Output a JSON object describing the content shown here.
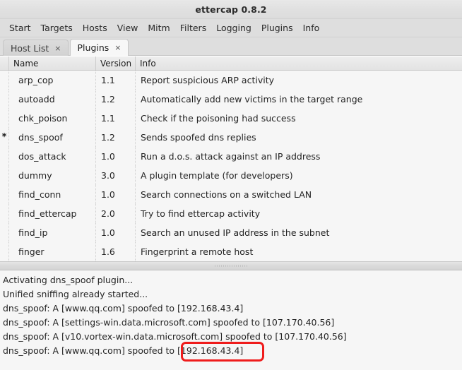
{
  "window": {
    "title": "ettercap 0.8.2"
  },
  "menubar": {
    "items": [
      {
        "label": "Start"
      },
      {
        "label": "Targets"
      },
      {
        "label": "Hosts"
      },
      {
        "label": "View"
      },
      {
        "label": "Mitm"
      },
      {
        "label": "Filters"
      },
      {
        "label": "Logging"
      },
      {
        "label": "Plugins"
      },
      {
        "label": "Info"
      }
    ]
  },
  "tabs": [
    {
      "label": "Host List",
      "close_glyph": "×",
      "active": false
    },
    {
      "label": "Plugins",
      "close_glyph": "×",
      "active": true
    }
  ],
  "plugin_table": {
    "columns": {
      "mark": "",
      "name": "Name",
      "version": "Version",
      "info": "Info"
    },
    "rows": [
      {
        "mark": "",
        "name": "arp_cop",
        "version": "1.1",
        "info": "Report suspicious ARP activity"
      },
      {
        "mark": "",
        "name": "autoadd",
        "version": "1.2",
        "info": "Automatically add new victims in the target range"
      },
      {
        "mark": "",
        "name": "chk_poison",
        "version": "1.1",
        "info": "Check if the poisoning had success"
      },
      {
        "mark": "*",
        "name": "dns_spoof",
        "version": "1.2",
        "info": "Sends spoofed dns replies"
      },
      {
        "mark": "",
        "name": "dos_attack",
        "version": "1.0",
        "info": "Run a d.o.s. attack against an IP address"
      },
      {
        "mark": "",
        "name": "dummy",
        "version": "3.0",
        "info": "A plugin template (for developers)"
      },
      {
        "mark": "",
        "name": "find_conn",
        "version": "1.0",
        "info": "Search connections on a switched LAN"
      },
      {
        "mark": "",
        "name": "find_ettercap",
        "version": "2.0",
        "info": "Try to find ettercap activity"
      },
      {
        "mark": "",
        "name": "find_ip",
        "version": "1.0",
        "info": "Search an unused IP address in the subnet"
      },
      {
        "mark": "",
        "name": "finger",
        "version": "1.6",
        "info": "Fingerprint a remote host"
      }
    ]
  },
  "log": {
    "lines": [
      "Activating dns_spoof plugin...",
      "Unified sniffing already started...",
      "dns_spoof: A [www.qq.com] spoofed to [192.168.43.4]",
      "dns_spoof: A [settings-win.data.microsoft.com] spoofed to [107.170.40.56]",
      "dns_spoof: A [v10.vortex-win.data.microsoft.com] spoofed to [107.170.40.56]",
      "dns_spoof: A [www.qq.com] spoofed to [192.168.43.4]"
    ]
  },
  "annotation": {
    "color": "#ef1c1c",
    "target_text": "[192.168.43.4]"
  }
}
